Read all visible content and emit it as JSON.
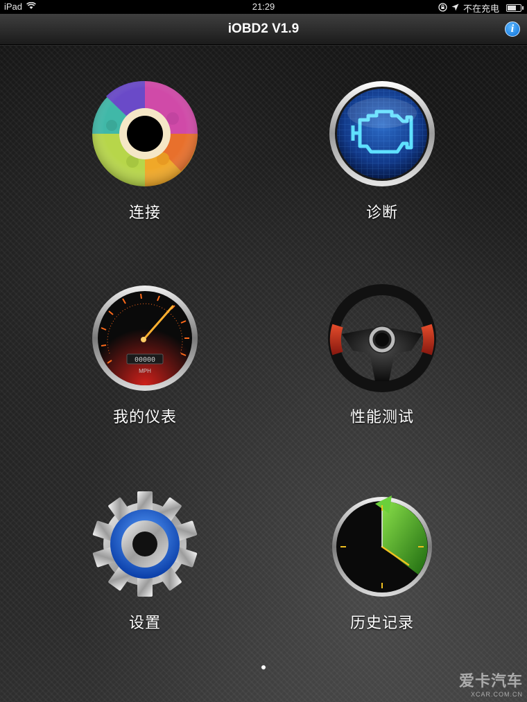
{
  "status_bar": {
    "device": "iPad",
    "time": "21:29",
    "charging": "不在充电"
  },
  "nav": {
    "title": "iOBD2 V1.9",
    "info": "i"
  },
  "menu": {
    "connect": "连接",
    "diagnose": "诊断",
    "dashboard": "我的仪表",
    "performance": "性能测试",
    "settings": "设置",
    "history": "历史记录"
  },
  "gauge_odometer": "00000",
  "gauge_unit": "MPH",
  "watermark": {
    "cn": "爱卡汽车",
    "en": "XCAR.COM.CN"
  },
  "colors": {
    "info_blue": "#0a6fd8",
    "accent_orange": "#ff6a1a",
    "engine_cyan": "#4fd4ff",
    "history_green": "#4caf2a"
  }
}
